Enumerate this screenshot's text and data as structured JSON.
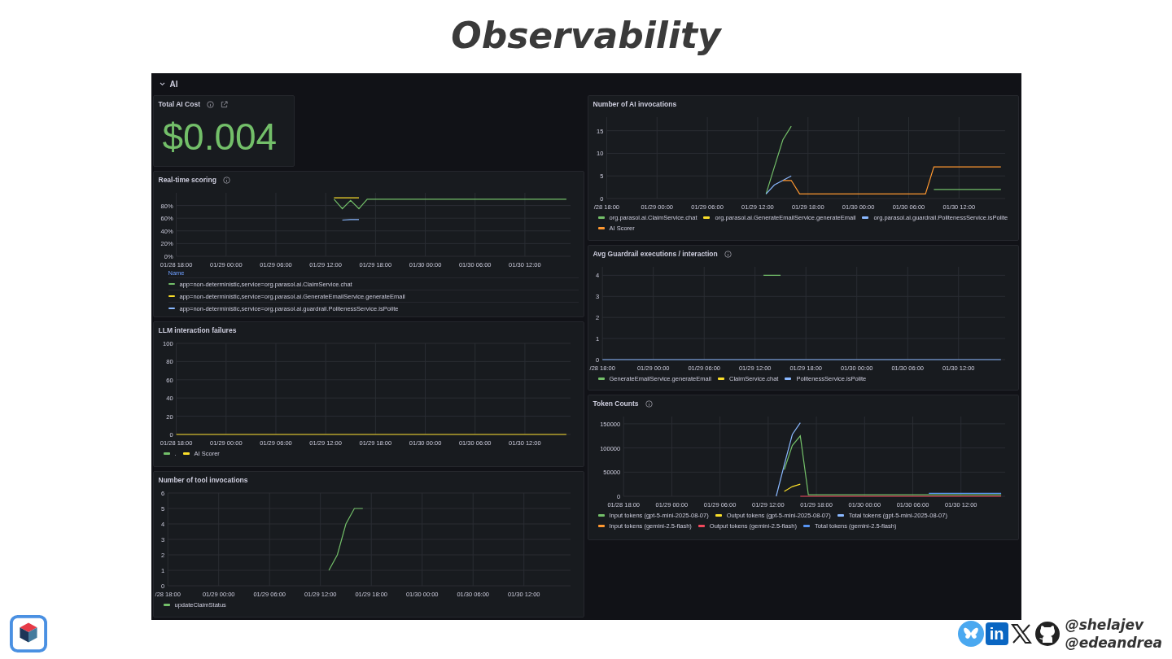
{
  "slide_title": "Observability",
  "dashboard": {
    "row_title": "AI",
    "stat_panel": {
      "title": "Total AI Cost",
      "value": "$0.004",
      "info_icon": true,
      "link_icon": true
    },
    "left_panels": [
      {
        "title": "Real-time scoring",
        "info_icon": true,
        "legend": {
          "kind": "table",
          "header": "Name"
        },
        "chart_data": {
          "type": "line",
          "grid": true,
          "ylim": [
            0,
            100
          ],
          "categories": [
            "01/28 18:00",
            null,
            null,
            null,
            null,
            null,
            "01/29 00:00",
            null,
            null,
            null,
            null,
            null,
            "01/29 06:00",
            null,
            null,
            null,
            null,
            null,
            "01/29 12:00",
            null,
            null,
            null,
            null,
            null,
            "01/29 18:00",
            null,
            null,
            null,
            null,
            null,
            "01/30 00:00",
            null,
            null,
            null,
            null,
            null,
            "01/30 06:00",
            null,
            null,
            null,
            null,
            null,
            "01/30 12:00",
            null,
            null,
            null,
            null,
            null
          ],
          "yticks": [
            {
              "value": 0,
              "label": "0%"
            },
            {
              "value": 20,
              "label": "20%"
            },
            {
              "value": 40,
              "label": "40%"
            },
            {
              "value": 60,
              "label": "60%"
            },
            {
              "value": 80,
              "label": "80%"
            }
          ],
          "series": [
            {
              "name": "app=non-deterministic,service=org.parasol.ai.ClaimService.chat",
              "color": "#73bf69",
              "values": [
                null,
                null,
                null,
                null,
                null,
                null,
                null,
                null,
                null,
                null,
                null,
                null,
                null,
                null,
                null,
                null,
                null,
                null,
                null,
                90,
                75,
                88,
                75,
                90,
                90,
                90,
                90,
                90,
                90,
                90,
                90,
                90,
                90,
                90,
                90,
                90,
                90,
                90,
                90,
                90,
                90,
                90,
                90,
                90,
                90,
                90,
                90,
                90
              ]
            },
            {
              "name": "app=non-deterministic,service=org.parasol.ai.GenerateEmailService.generateEmail",
              "color": "#fade2a",
              "values": [
                null,
                null,
                null,
                null,
                null,
                null,
                null,
                null,
                null,
                null,
                null,
                null,
                null,
                null,
                null,
                null,
                null,
                null,
                null,
                92,
                92,
                92,
                92,
                null,
                null,
                null,
                null,
                null,
                null,
                null,
                null,
                null,
                null,
                null,
                null,
                null,
                null,
                null,
                null,
                null,
                null,
                null,
                null,
                null,
                null,
                null,
                null,
                null
              ]
            },
            {
              "name": "app=non-deterministic,service=org.parasol.ai.guardrail.PolitenessService.isPolite",
              "color": "#8ab8ff",
              "values": [
                null,
                null,
                null,
                null,
                null,
                null,
                null,
                null,
                null,
                null,
                null,
                null,
                null,
                null,
                null,
                null,
                null,
                null,
                null,
                null,
                57,
                58,
                58,
                null,
                null,
                null,
                null,
                null,
                null,
                null,
                null,
                null,
                null,
                null,
                null,
                null,
                null,
                null,
                null,
                null,
                null,
                null,
                null,
                null,
                null,
                null,
                null,
                null
              ]
            }
          ]
        }
      },
      {
        "title": "LLM interaction failures",
        "info_icon": false,
        "legend": {
          "kind": "list"
        },
        "chart_data": {
          "type": "line",
          "grid": true,
          "ylim": [
            0,
            100
          ],
          "categories": [
            "01/28 18:00",
            null,
            null,
            null,
            null,
            null,
            "01/29 00:00",
            null,
            null,
            null,
            null,
            null,
            "01/29 06:00",
            null,
            null,
            null,
            null,
            null,
            "01/29 12:00",
            null,
            null,
            null,
            null,
            null,
            "01/29 18:00",
            null,
            null,
            null,
            null,
            null,
            "01/30 00:00",
            null,
            null,
            null,
            null,
            null,
            "01/30 06:00",
            null,
            null,
            null,
            null,
            null,
            "01/30 12:00",
            null,
            null,
            null,
            null,
            null
          ],
          "yticks": [
            0,
            20,
            40,
            60,
            80,
            100
          ],
          "series": [
            {
              "name": ".",
              "color": "#73bf69",
              "values": [
                null,
                null,
                null,
                null,
                null,
                null,
                null,
                null,
                null,
                null,
                null,
                null,
                null,
                null,
                null,
                null,
                null,
                null,
                null,
                null,
                null,
                null,
                null,
                null,
                null,
                null,
                null,
                null,
                null,
                null,
                null,
                null,
                null,
                null,
                null,
                null,
                null,
                null,
                null,
                null,
                null,
                null,
                null,
                null,
                null,
                null,
                null,
                null
              ]
            },
            {
              "name": "AI Scorer",
              "color": "#fade2a",
              "values": [
                0,
                0,
                0,
                0,
                0,
                0,
                0,
                0,
                0,
                0,
                0,
                0,
                0,
                0,
                0,
                0,
                0,
                0,
                0,
                0,
                0,
                0,
                0,
                0,
                0,
                0,
                0,
                0,
                0,
                0,
                0,
                0,
                0,
                0,
                0,
                0,
                0,
                0,
                0,
                0,
                0,
                0,
                0,
                0,
                0,
                0,
                0,
                0
              ]
            }
          ]
        }
      },
      {
        "title": "Number of tool invocations",
        "info_icon": false,
        "legend": {
          "kind": "list"
        },
        "chart_data": {
          "type": "line",
          "grid": true,
          "ylim": [
            0,
            6
          ],
          "categories": [
            "/28 18:00",
            null,
            null,
            null,
            null,
            null,
            "01/29 00:00",
            null,
            null,
            null,
            null,
            null,
            "01/29 06:00",
            null,
            null,
            null,
            null,
            null,
            "01/29 12:00",
            null,
            null,
            null,
            null,
            null,
            "01/29 18:00",
            null,
            null,
            null,
            null,
            null,
            "01/30 00:00",
            null,
            null,
            null,
            null,
            null,
            "01/30 06:00",
            null,
            null,
            null,
            null,
            null,
            "01/30 12:00",
            null,
            null,
            null,
            null,
            null
          ],
          "yticks": [
            0,
            1,
            2,
            3,
            4,
            5,
            6
          ],
          "series": [
            {
              "name": "updateClaimStatus",
              "color": "#73bf69",
              "values": [
                null,
                null,
                null,
                null,
                null,
                null,
                null,
                null,
                null,
                null,
                null,
                null,
                null,
                null,
                null,
                null,
                null,
                null,
                null,
                1,
                2,
                4,
                5,
                5,
                null,
                null,
                null,
                null,
                null,
                null,
                null,
                null,
                null,
                null,
                null,
                null,
                null,
                null,
                null,
                null,
                null,
                null,
                null,
                null,
                null,
                null,
                null,
                null
              ]
            }
          ]
        }
      }
    ],
    "right_panels": [
      {
        "title": "Number of AI invocations",
        "info_icon": false,
        "legend": {
          "kind": "list"
        },
        "chart_data": {
          "type": "line",
          "grid": true,
          "ylim": [
            0,
            18
          ],
          "categories": [
            "/28 18:00",
            null,
            null,
            null,
            null,
            null,
            "01/29 00:00",
            null,
            null,
            null,
            null,
            null,
            "01/29 06:00",
            null,
            null,
            null,
            null,
            null,
            "01/29 12:00",
            null,
            null,
            null,
            null,
            null,
            "01/29 18:00",
            null,
            null,
            null,
            null,
            null,
            "01/30 00:00",
            null,
            null,
            null,
            null,
            null,
            "01/30 06:00",
            null,
            null,
            null,
            null,
            null,
            "01/30 12:00",
            null,
            null,
            null,
            null,
            null
          ],
          "yticks": [
            0,
            5,
            10,
            15
          ],
          "series": [
            {
              "name": "org.parasol.ai.ClaimService.chat",
              "color": "#73bf69",
              "values": [
                null,
                null,
                null,
                null,
                null,
                null,
                null,
                null,
                null,
                null,
                null,
                null,
                null,
                null,
                null,
                null,
                null,
                null,
                null,
                1,
                7,
                13,
                16,
                null,
                null,
                null,
                null,
                null,
                null,
                null,
                null,
                null,
                null,
                null,
                null,
                null,
                null,
                null,
                null,
                2,
                2,
                2,
                2,
                2,
                2,
                2,
                2,
                2
              ]
            },
            {
              "name": "org.parasol.ai.GenerateEmailService.generateEmail",
              "color": "#fade2a",
              "values": [
                null,
                null,
                null,
                null,
                null,
                null,
                null,
                null,
                null,
                null,
                null,
                null,
                null,
                null,
                null,
                null,
                null,
                null,
                null,
                null,
                null,
                null,
                null,
                null,
                null,
                null,
                null,
                null,
                null,
                null,
                null,
                null,
                null,
                null,
                null,
                null,
                null,
                null,
                null,
                null,
                null,
                null,
                null,
                null,
                null,
                null,
                null,
                null
              ]
            },
            {
              "name": "org.parasol.ai.guardrail.PolitenessService.isPolite",
              "color": "#8ab8ff",
              "values": [
                null,
                null,
                null,
                null,
                null,
                null,
                null,
                null,
                null,
                null,
                null,
                null,
                null,
                null,
                null,
                null,
                null,
                null,
                null,
                1,
                3,
                4,
                5,
                null,
                null,
                null,
                null,
                null,
                null,
                null,
                null,
                null,
                null,
                null,
                null,
                null,
                null,
                null,
                null,
                null,
                null,
                null,
                null,
                null,
                null,
                null,
                null,
                null
              ]
            },
            {
              "name": "AI Scorer",
              "color": "#ff9830",
              "values": [
                null,
                null,
                null,
                null,
                null,
                null,
                null,
                null,
                null,
                null,
                null,
                null,
                null,
                null,
                null,
                null,
                null,
                null,
                null,
                null,
                null,
                4,
                4,
                1,
                1,
                1,
                1,
                1,
                1,
                1,
                1,
                1,
                1,
                1,
                1,
                1,
                1,
                1,
                1,
                7,
                7,
                7,
                7,
                7,
                7,
                7,
                7,
                7
              ]
            }
          ]
        }
      },
      {
        "title": "Avg Guardrail executions / interaction",
        "info_icon": true,
        "legend": {
          "kind": "list"
        },
        "chart_data": {
          "type": "line",
          "grid": true,
          "ylim": [
            0,
            4.4
          ],
          "categories": [
            "/28 18:00",
            null,
            null,
            null,
            null,
            null,
            "01/29 00:00",
            null,
            null,
            null,
            null,
            null,
            "01/29 06:00",
            null,
            null,
            null,
            null,
            null,
            "01/29 12:00",
            null,
            null,
            null,
            null,
            null,
            "01/29 18:00",
            null,
            null,
            null,
            null,
            null,
            "01/30 00:00",
            null,
            null,
            null,
            null,
            null,
            "01/30 06:00",
            null,
            null,
            null,
            null,
            null,
            "01/30 12:00",
            null,
            null,
            null,
            null,
            null
          ],
          "yticks": [
            0,
            1,
            2,
            3,
            4
          ],
          "series": [
            {
              "name": "GenerateEmailService.generateEmail",
              "color": "#73bf69",
              "values": [
                null,
                null,
                null,
                null,
                null,
                null,
                null,
                null,
                null,
                null,
                null,
                null,
                null,
                null,
                null,
                null,
                null,
                null,
                null,
                4,
                4,
                4,
                null,
                null,
                null,
                null,
                null,
                null,
                null,
                null,
                null,
                null,
                null,
                null,
                null,
                null,
                null,
                null,
                null,
                null,
                null,
                null,
                null,
                null,
                null,
                null,
                null,
                null
              ]
            },
            {
              "name": "ClaimService.chat",
              "color": "#fade2a",
              "values": [
                null,
                null,
                null,
                null,
                null,
                null,
                null,
                null,
                null,
                null,
                null,
                null,
                null,
                null,
                null,
                null,
                null,
                null,
                null,
                null,
                null,
                null,
                null,
                null,
                null,
                null,
                null,
                null,
                null,
                null,
                null,
                null,
                null,
                null,
                null,
                null,
                null,
                null,
                null,
                null,
                null,
                null,
                null,
                null,
                null,
                null,
                null,
                null
              ]
            },
            {
              "name": "PolitenessService.isPolite",
              "color": "#8ab8ff",
              "values": [
                0,
                0,
                0,
                0,
                0,
                0,
                0,
                0,
                0,
                0,
                0,
                0,
                0,
                0,
                0,
                0,
                0,
                0,
                0,
                0,
                0,
                0,
                0,
                0,
                0,
                0,
                0,
                0,
                0,
                0,
                0,
                0,
                0,
                0,
                0,
                0,
                0,
                0,
                0,
                0,
                0,
                0,
                0,
                0,
                0,
                0,
                0,
                0
              ]
            }
          ]
        }
      },
      {
        "title": "Token Counts",
        "info_icon": true,
        "legend": {
          "kind": "list"
        },
        "chart_data": {
          "type": "line",
          "grid": true,
          "ylim": [
            0,
            165000
          ],
          "categories": [
            "01/28 18:00",
            null,
            null,
            null,
            null,
            null,
            "01/29 00:00",
            null,
            null,
            null,
            null,
            null,
            "01/29 06:00",
            null,
            null,
            null,
            null,
            null,
            "01/29 12:00",
            null,
            null,
            null,
            null,
            null,
            "01/29 18:00",
            null,
            null,
            null,
            null,
            null,
            "01/30 00:00",
            null,
            null,
            null,
            null,
            null,
            "01/30 06:00",
            null,
            null,
            null,
            null,
            null,
            "01/30 12:00",
            null,
            null,
            null,
            null,
            null
          ],
          "yticks": [
            0,
            50000,
            100000,
            150000
          ],
          "series": [
            {
              "name": "Input tokens (gpt-5-mini-2025-08-07)",
              "color": "#73bf69",
              "values": [
                null,
                null,
                null,
                null,
                null,
                null,
                null,
                null,
                null,
                null,
                null,
                null,
                null,
                null,
                null,
                null,
                null,
                null,
                null,
                null,
                55000,
                105000,
                125000,
                3000,
                3000,
                3000,
                3000,
                3000,
                3000,
                3000,
                3000,
                3000,
                3000,
                3000,
                3000,
                3000,
                3000,
                3000,
                3000,
                3000,
                3000,
                3000,
                3000,
                3000,
                3000,
                3000,
                3000,
                3000
              ]
            },
            {
              "name": "Output tokens (gpt-5-mini-2025-08-07)",
              "color": "#fade2a",
              "values": [
                null,
                null,
                null,
                null,
                null,
                null,
                null,
                null,
                null,
                null,
                null,
                null,
                null,
                null,
                null,
                null,
                null,
                null,
                null,
                null,
                10000,
                20000,
                25000,
                null,
                null,
                null,
                null,
                null,
                null,
                null,
                null,
                null,
                null,
                null,
                null,
                null,
                null,
                null,
                null,
                null,
                null,
                null,
                null,
                null,
                null,
                null,
                null,
                null
              ]
            },
            {
              "name": "Total tokens (gpt-5-mini-2025-08-07)",
              "color": "#8ab8ff",
              "values": [
                null,
                null,
                null,
                null,
                null,
                null,
                null,
                null,
                null,
                null,
                null,
                null,
                null,
                null,
                null,
                null,
                null,
                null,
                null,
                0,
                65000,
                128000,
                152000,
                null,
                null,
                null,
                null,
                null,
                null,
                null,
                null,
                null,
                null,
                null,
                null,
                null,
                null,
                null,
                null,
                null,
                null,
                null,
                null,
                null,
                null,
                null,
                null,
                null
              ]
            },
            {
              "name": "Input tokens (gemini-2.5-flash)",
              "color": "#ff9830",
              "values": [
                null,
                null,
                null,
                null,
                null,
                null,
                null,
                null,
                null,
                null,
                null,
                null,
                null,
                null,
                null,
                null,
                null,
                null,
                null,
                null,
                null,
                null,
                null,
                null,
                null,
                null,
                null,
                null,
                null,
                null,
                null,
                null,
                null,
                null,
                null,
                null,
                null,
                null,
                null,
                null,
                null,
                null,
                null,
                null,
                null,
                null,
                null,
                null
              ]
            },
            {
              "name": "Output tokens (gemini-2.5-flash)",
              "color": "#f2495c",
              "values": [
                null,
                null,
                null,
                null,
                null,
                null,
                null,
                null,
                null,
                null,
                null,
                null,
                null,
                null,
                null,
                null,
                null,
                null,
                null,
                null,
                null,
                null,
                0,
                0,
                0,
                0,
                0,
                0,
                0,
                0,
                0,
                0,
                0,
                0,
                0,
                0,
                0,
                0,
                0,
                0,
                0,
                0,
                0,
                0,
                0,
                0,
                0,
                0
              ]
            },
            {
              "name": "Total tokens (gemini-2.5-flash)",
              "color": "#5794f2",
              "values": [
                null,
                null,
                null,
                null,
                null,
                null,
                null,
                null,
                null,
                null,
                null,
                null,
                null,
                null,
                null,
                null,
                null,
                null,
                null,
                null,
                null,
                null,
                null,
                null,
                null,
                null,
                null,
                null,
                null,
                null,
                null,
                null,
                null,
                null,
                null,
                null,
                null,
                null,
                6000,
                6000,
                6000,
                6000,
                6000,
                6000,
                6000,
                6000,
                6000,
                6000
              ]
            }
          ]
        }
      }
    ]
  },
  "footer": {
    "linkedin_label": "in",
    "handles": [
      "@shelajev",
      "@edeandrea"
    ]
  }
}
